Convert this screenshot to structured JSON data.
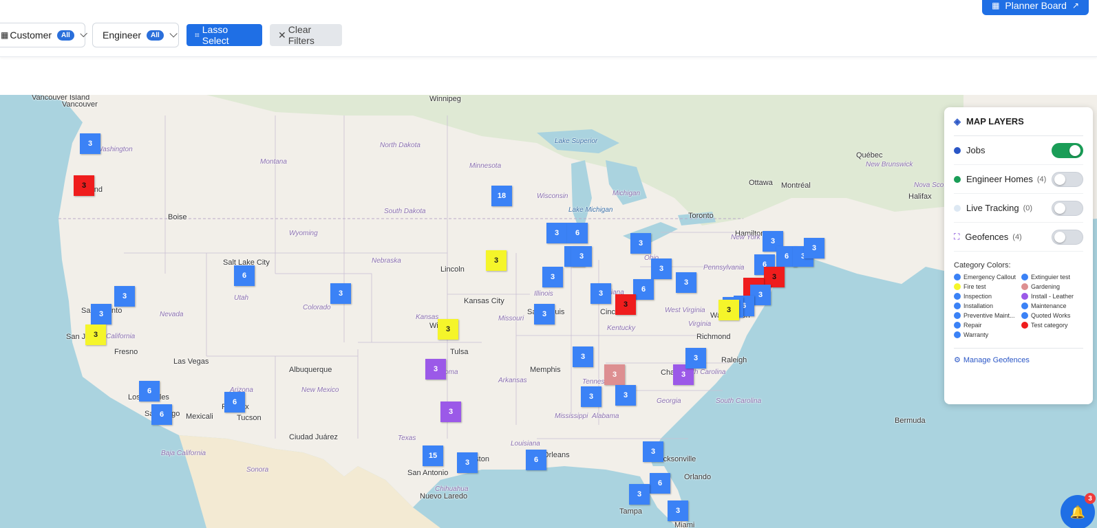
{
  "filters": {
    "customer": {
      "label": "Customer",
      "badge": "All"
    },
    "engineer": {
      "label": "Engineer",
      "badge": "All"
    },
    "lasso": "Lasso Select",
    "clear": "Clear Filters",
    "planner": "Planner Board"
  },
  "map": {
    "places": [
      {
        "t": "Vancouver Island",
        "c": "city"
      },
      {
        "t": "Vancouver",
        "c": "city"
      },
      {
        "t": "Winnipeg",
        "c": "city"
      },
      {
        "t": "Washington",
        "c": "state"
      },
      {
        "t": "North Dakota",
        "c": "state"
      },
      {
        "t": "Montana",
        "c": "state"
      },
      {
        "t": "Minnesota",
        "c": "state"
      },
      {
        "t": "Lake Superior",
        "c": "water"
      },
      {
        "t": "Québec",
        "c": "city"
      },
      {
        "t": "New Brunswick",
        "c": "state"
      },
      {
        "t": "Nova Scotia",
        "c": "state"
      },
      {
        "t": "Halifax",
        "c": "city"
      },
      {
        "t": "Portland",
        "c": "city"
      },
      {
        "t": "Boise",
        "c": "city"
      },
      {
        "t": "South Dakota",
        "c": "state"
      },
      {
        "t": "Wisconsin",
        "c": "state"
      },
      {
        "t": "Michigan",
        "c": "state"
      },
      {
        "t": "Lake Michigan",
        "c": "water"
      },
      {
        "t": "Ottawa",
        "c": "city"
      },
      {
        "t": "Montréal",
        "c": "city"
      },
      {
        "t": "Toronto",
        "c": "city"
      },
      {
        "t": "Hamilton",
        "c": "city"
      },
      {
        "t": "Wyoming",
        "c": "state"
      },
      {
        "t": "Salt Lake City",
        "c": "city"
      },
      {
        "t": "Nebraska",
        "c": "state"
      },
      {
        "t": "Lincoln",
        "c": "city"
      },
      {
        "t": "New York",
        "c": "state"
      },
      {
        "t": "Pennsylvania",
        "c": "state"
      },
      {
        "t": "Ohio",
        "c": "state"
      },
      {
        "t": "Nevada",
        "c": "state"
      },
      {
        "t": "Utah",
        "c": "state"
      },
      {
        "t": "Colorado",
        "c": "state"
      },
      {
        "t": "Kansas City",
        "c": "city"
      },
      {
        "t": "Illinois",
        "c": "state"
      },
      {
        "t": "Indiana",
        "c": "state"
      },
      {
        "t": "Cincinnati",
        "c": "city"
      },
      {
        "t": "West Virginia",
        "c": "state"
      },
      {
        "t": "Washington",
        "c": "city"
      },
      {
        "t": "Sacramento",
        "c": "city"
      },
      {
        "t": "San Jose",
        "c": "city"
      },
      {
        "t": "California",
        "c": "state"
      },
      {
        "t": "Fresno",
        "c": "city"
      },
      {
        "t": "Kansas",
        "c": "state"
      },
      {
        "t": "Wichita",
        "c": "city"
      },
      {
        "t": "Missouri",
        "c": "state"
      },
      {
        "t": "Saint Louis",
        "c": "city"
      },
      {
        "t": "Kentucky",
        "c": "state"
      },
      {
        "t": "Virginia",
        "c": "state"
      },
      {
        "t": "Richmond",
        "c": "city"
      },
      {
        "t": "Raleigh",
        "c": "city"
      },
      {
        "t": "Las Vegas",
        "c": "city"
      },
      {
        "t": "Albuquerque",
        "c": "city"
      },
      {
        "t": "Tulsa",
        "c": "city"
      },
      {
        "t": "Memphis",
        "c": "city"
      },
      {
        "t": "Tennessee",
        "c": "state"
      },
      {
        "t": "Arkansas",
        "c": "state"
      },
      {
        "t": "Oklahoma",
        "c": "state"
      },
      {
        "t": "Charlotte",
        "c": "city"
      },
      {
        "t": "North Carolina",
        "c": "state"
      },
      {
        "t": "Arizona",
        "c": "state"
      },
      {
        "t": "New Mexico",
        "c": "state"
      },
      {
        "t": "Los Angeles",
        "c": "city"
      },
      {
        "t": "Phoenix",
        "c": "city"
      },
      {
        "t": "San Diego",
        "c": "city"
      },
      {
        "t": "Mexicali",
        "c": "city"
      },
      {
        "t": "Tucson",
        "c": "city"
      },
      {
        "t": "Mississippi",
        "c": "state"
      },
      {
        "t": "Alabama",
        "c": "state"
      },
      {
        "t": "Georgia",
        "c": "state"
      },
      {
        "t": "South Carolina",
        "c": "state"
      },
      {
        "t": "Bermuda",
        "c": "city"
      },
      {
        "t": "Ciudad Juárez",
        "c": "city"
      },
      {
        "t": "Texas",
        "c": "state"
      },
      {
        "t": "Louisiana",
        "c": "state"
      },
      {
        "t": "New Orleans",
        "c": "city"
      },
      {
        "t": "Jacksonville",
        "c": "city"
      },
      {
        "t": "Orlando",
        "c": "city"
      },
      {
        "t": "Baja California",
        "c": "state"
      },
      {
        "t": "Sonora",
        "c": "state"
      },
      {
        "t": "Chihuahua",
        "c": "state"
      },
      {
        "t": "San Antonio",
        "c": "city"
      },
      {
        "t": "Houston",
        "c": "city"
      },
      {
        "t": "Nuevo Laredo",
        "c": "city"
      },
      {
        "t": "Tampa",
        "c": "city"
      },
      {
        "t": "Miami",
        "c": "city"
      }
    ],
    "markers": [
      {
        "n": "3",
        "c": "blue"
      },
      {
        "n": "3",
        "c": "red"
      },
      {
        "n": "18",
        "c": "blue"
      },
      {
        "n": "3",
        "c": "blue"
      },
      {
        "n": "6",
        "c": "blue"
      },
      {
        "n": "3",
        "c": "blue"
      },
      {
        "n": "3",
        "c": "yellow"
      },
      {
        "n": "3",
        "c": "blue"
      },
      {
        "n": "3",
        "c": "blue"
      },
      {
        "n": "3",
        "c": "blue"
      },
      {
        "n": "3",
        "c": "blue"
      },
      {
        "n": "3",
        "c": "blue"
      },
      {
        "n": "6",
        "c": "blue"
      },
      {
        "n": "3",
        "c": "blue"
      },
      {
        "n": "3",
        "c": "blue"
      },
      {
        "n": "3",
        "c": "blue"
      },
      {
        "n": "6",
        "c": "blue"
      },
      {
        "n": "6",
        "c": "blue"
      },
      {
        "n": "3",
        "c": "red"
      },
      {
        "n": "3",
        "c": "red"
      },
      {
        "n": "3",
        "c": "blue"
      },
      {
        "n": "3",
        "c": "blue"
      },
      {
        "n": "3",
        "c": "red"
      },
      {
        "n": "6",
        "c": "blue"
      },
      {
        "n": "3",
        "c": "blue"
      },
      {
        "n": "3",
        "c": "yellow"
      },
      {
        "n": "3",
        "c": "blue"
      },
      {
        "n": "3",
        "c": "blue"
      },
      {
        "n": "3",
        "c": "blue"
      },
      {
        "n": "6",
        "c": "blue"
      },
      {
        "n": "3",
        "c": "yellow"
      },
      {
        "n": "3",
        "c": "yellow"
      },
      {
        "n": "3",
        "c": "blue"
      },
      {
        "n": "3",
        "c": "purple"
      },
      {
        "n": "3",
        "c": "blue"
      },
      {
        "n": "3",
        "c": "pink"
      },
      {
        "n": "3",
        "c": "purple"
      },
      {
        "n": "3",
        "c": "blue"
      },
      {
        "n": "3",
        "c": "blue"
      },
      {
        "n": "3",
        "c": "blue"
      },
      {
        "n": "3",
        "c": "purple"
      },
      {
        "n": "6",
        "c": "blue"
      },
      {
        "n": "6",
        "c": "blue"
      },
      {
        "n": "6",
        "c": "blue"
      },
      {
        "n": "15",
        "c": "blue"
      },
      {
        "n": "3",
        "c": "blue"
      },
      {
        "n": "6",
        "c": "blue"
      },
      {
        "n": "3",
        "c": "blue"
      },
      {
        "n": "6",
        "c": "blue"
      },
      {
        "n": "3",
        "c": "blue"
      },
      {
        "n": "3",
        "c": "blue"
      }
    ]
  },
  "layers": {
    "title": "MAP LAYERS",
    "items": [
      {
        "label": "Jobs",
        "count": "",
        "color": "#2a56c6",
        "on": true
      },
      {
        "label": "Engineer Homes",
        "count": "(4)",
        "color": "#1a9d57",
        "on": false
      },
      {
        "label": "Live Tracking",
        "count": "(0)",
        "color": "#dde8f3",
        "on": false
      },
      {
        "label": "Geofences",
        "count": "(4)",
        "color": "#7b3fd6",
        "on": false,
        "icon": "geofence-icon"
      }
    ],
    "category_title": "Category Colors:",
    "categories": [
      {
        "label": "Emergency Callout",
        "color": "#3b82f6"
      },
      {
        "label": "Extinguier test",
        "color": "#3b82f6"
      },
      {
        "label": "Fire test",
        "color": "#f5f52a"
      },
      {
        "label": "Gardening",
        "color": "#dd8f91"
      },
      {
        "label": "Inspection",
        "color": "#3b82f6"
      },
      {
        "label": "Install - Leather",
        "color": "#9b59e8"
      },
      {
        "label": "Installation",
        "color": "#3b82f6"
      },
      {
        "label": "Maintenance",
        "color": "#3b82f6"
      },
      {
        "label": "Preventive Maint...",
        "color": "#3b82f6"
      },
      {
        "label": "Quoted Works",
        "color": "#3b82f6"
      },
      {
        "label": "Repair",
        "color": "#3b82f6"
      },
      {
        "label": "Test category",
        "color": "#ef1d1d"
      },
      {
        "label": "Warranty",
        "color": "#3b82f6"
      }
    ],
    "manage": "Manage Geofences"
  },
  "notifications": {
    "count": "3"
  }
}
